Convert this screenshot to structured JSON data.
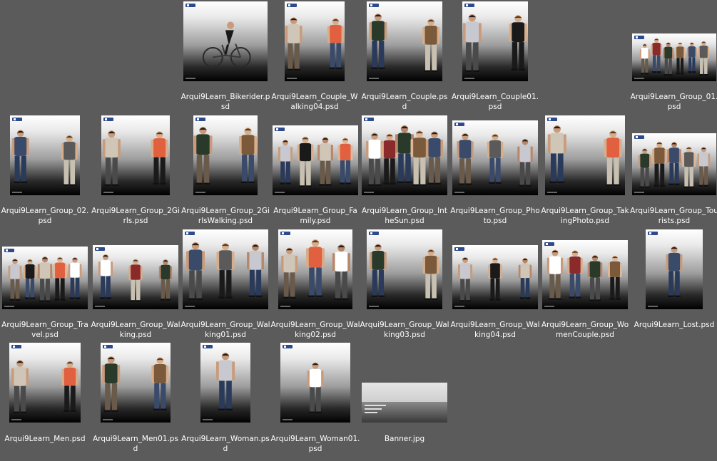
{
  "files": [
    {
      "name": "Arqui9Learn_Bikerider.psd",
      "icon": "bikerider-thumbnail",
      "figures": 1,
      "kind": "bike"
    },
    {
      "name": "Arqui9Learn_Couple_Walking04.psd",
      "icon": "couple-walking-thumbnail",
      "figures": 2,
      "kind": "people"
    },
    {
      "name": "Arqui9Learn_Couple.psd",
      "icon": "couple-thumbnail",
      "figures": 2,
      "kind": "people"
    },
    {
      "name": "Arqui9Learn_Couple01.psd",
      "icon": "couple-thumbnail",
      "figures": 2,
      "kind": "people"
    },
    {
      "name": "Arqui9Learn_Group_01.psd",
      "icon": "group-thumbnail",
      "figures": 6,
      "kind": "people"
    },
    {
      "name": "Arqui9Learn_Group_02.psd",
      "icon": "group-thumbnail",
      "figures": 2,
      "kind": "people"
    },
    {
      "name": "Arqui9Learn_Group_2Girls.psd",
      "icon": "group-thumbnail",
      "figures": 2,
      "kind": "people"
    },
    {
      "name": "Arqui9Learn_Group_2GirlsWalking.psd",
      "icon": "group-thumbnail",
      "figures": 2,
      "kind": "people"
    },
    {
      "name": "Arqui9Learn_Group_Family.psd",
      "icon": "group-family-thumbnail",
      "figures": 4,
      "kind": "people"
    },
    {
      "name": "Arqui9Learn_Group_IntheSun.psd",
      "icon": "group-thumbnail",
      "figures": 5,
      "kind": "people"
    },
    {
      "name": "Arqui9Learn_Group_Photo.psd",
      "icon": "group-photo-thumbnail",
      "figures": 3,
      "kind": "people"
    },
    {
      "name": "Arqui9Learn_Group_TakingPhoto.psd",
      "icon": "group-photo-thumbnail",
      "figures": 2,
      "kind": "people"
    },
    {
      "name": "Arqui9Learn_Group_Tourists.psd",
      "icon": "group-thumbnail",
      "figures": 5,
      "kind": "people"
    },
    {
      "name": "Arqui9Learn_Group_Travel.psd",
      "icon": "group-travel-thumbnail",
      "figures": 5,
      "kind": "people"
    },
    {
      "name": "Arqui9Learn_Group_Walking.psd",
      "icon": "group-walking-thumbnail",
      "figures": 3,
      "kind": "people"
    },
    {
      "name": "Arqui9Learn_Group_Walking01.psd",
      "icon": "group-walking-thumbnail",
      "figures": 3,
      "kind": "people"
    },
    {
      "name": "Arqui9Learn_Group_Walking02.psd",
      "icon": "group-walking-thumbnail",
      "figures": 3,
      "kind": "people"
    },
    {
      "name": "Arqui9Learn_Group_Walking03.psd",
      "icon": "group-walking-thumbnail",
      "figures": 2,
      "kind": "people"
    },
    {
      "name": "Arqui9Learn_Group_Walking04.psd",
      "icon": "group-walking-thumbnail",
      "figures": 3,
      "kind": "people"
    },
    {
      "name": "Arqui9Learn_Group_WomenCouple.psd",
      "icon": "group-thumbnail",
      "figures": 4,
      "kind": "people"
    },
    {
      "name": "Arqui9Learn_Lost.psd",
      "icon": "person-thumbnail",
      "figures": 1,
      "kind": "people"
    },
    {
      "name": "Arqui9Learn_Men.psd",
      "icon": "men-thumbnail",
      "figures": 2,
      "kind": "people"
    },
    {
      "name": "Arqui9Learn_Men01.psd",
      "icon": "men-thumbnail",
      "figures": 2,
      "kind": "people"
    },
    {
      "name": "Arqui9Learn_Woman.psd",
      "icon": "woman-thumbnail",
      "figures": 1,
      "kind": "people"
    },
    {
      "name": "Arqui9Learn_Woman01.psd",
      "icon": "woman-thumbnail",
      "figures": 1,
      "kind": "people"
    },
    {
      "name": "Banner.jpg",
      "icon": "banner-thumbnail",
      "figures": 0,
      "kind": "banner"
    }
  ],
  "colors": {
    "background": "#5b5b5b",
    "label": "#ffffff",
    "logo": "#2c4a8c"
  }
}
